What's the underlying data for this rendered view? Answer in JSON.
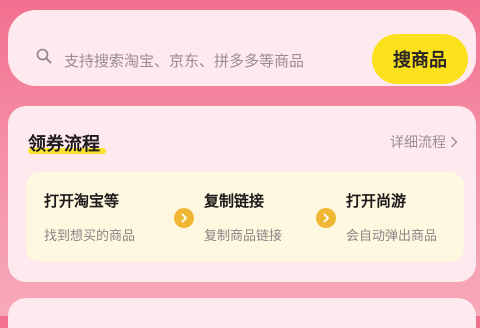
{
  "search": {
    "placeholder": "支持搜索淘宝、京东、拼多多等商品",
    "button_label": "搜商品"
  },
  "flow": {
    "title": "领券流程",
    "detail_link": "详细流程",
    "steps": [
      {
        "title": "打开淘宝等",
        "desc": "找到想买的商品"
      },
      {
        "title": "复制链接",
        "desc": "复制商品链接"
      },
      {
        "title": "打开尚游",
        "desc": "会自动弹出商品"
      }
    ]
  },
  "icons": {
    "search": "search-icon",
    "chevron": "chevron-right-icon",
    "step_arrow": "arrow-right-circle-icon"
  },
  "colors": {
    "accent_yellow": "#fbe11c",
    "arrow_orange": "#f0b734",
    "background_pink": "#f2708f"
  }
}
